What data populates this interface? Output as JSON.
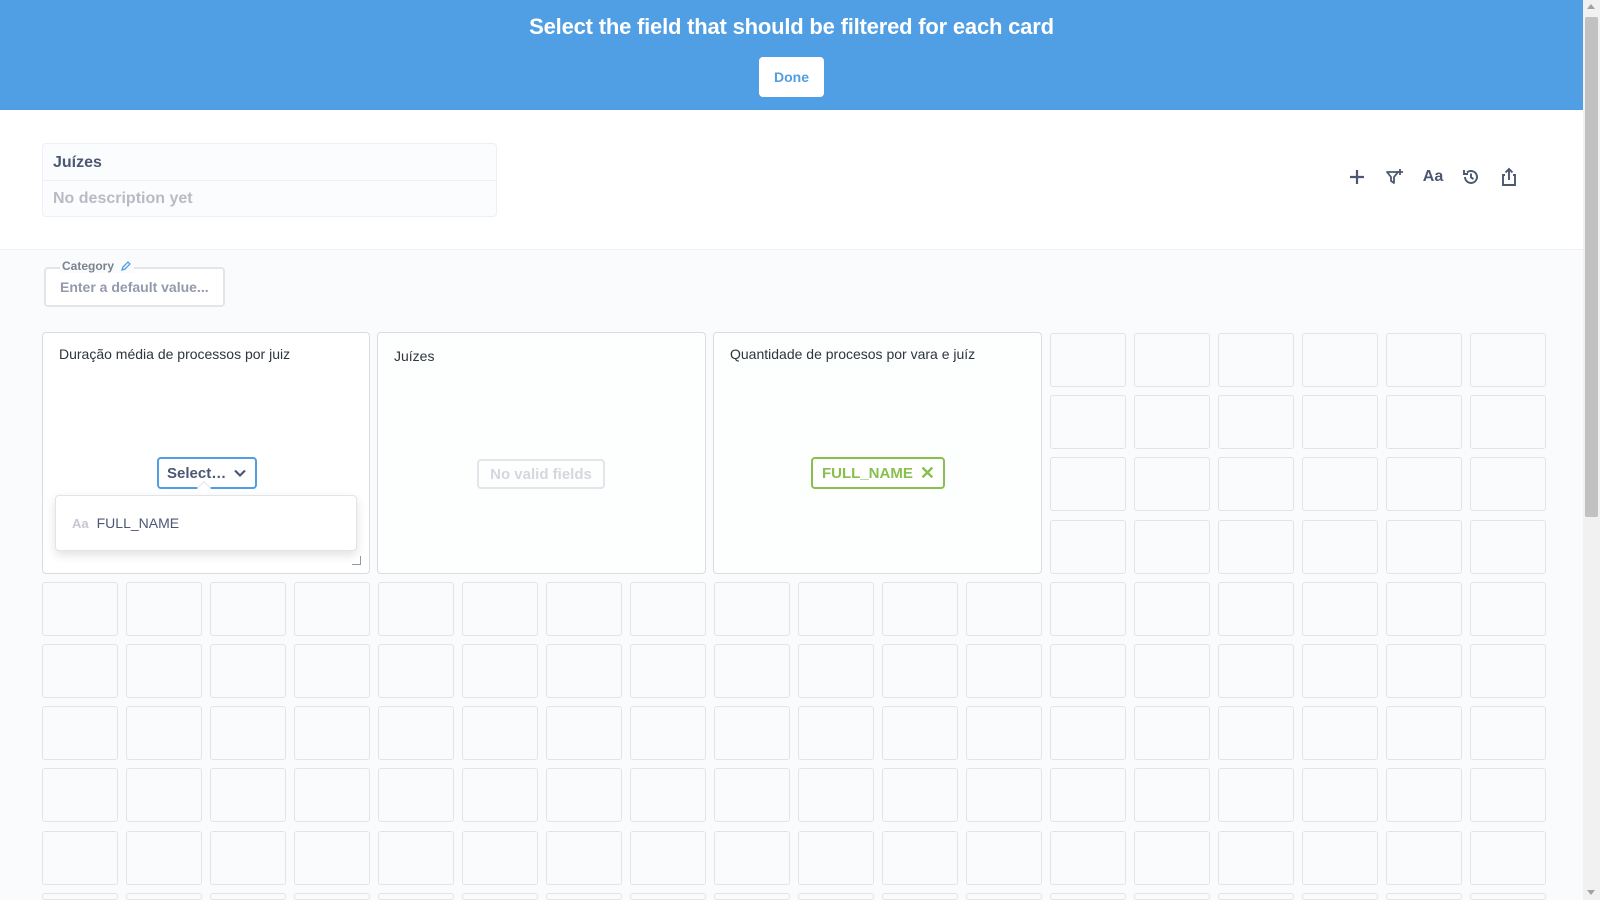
{
  "banner": {
    "title": "Select the field that should be filtered for each card",
    "done_label": "Done"
  },
  "dashboard": {
    "name": "Juízes",
    "description_placeholder": "No description yet"
  },
  "toolbar": {
    "icons": [
      "plus-icon",
      "filter-add-icon",
      "text-icon",
      "history-icon",
      "share-icon"
    ],
    "text_icon_label": "Aa"
  },
  "parameter": {
    "label": "Category",
    "placeholder": "Enter a default value..."
  },
  "cards": [
    {
      "title": "Duração média de processos por juiz",
      "select_label": "Select…",
      "dropdown_item": "FULL_NAME",
      "dropdown_item_icon": "Aa"
    },
    {
      "title": "Juízes",
      "status": "No valid fields"
    },
    {
      "title": "Quantidade de procesos por vara e juíz",
      "mapped_field": "FULL_NAME"
    }
  ],
  "colors": {
    "brand": "#509ee3",
    "success": "#88bf4d",
    "text_dark": "#4c5773"
  }
}
